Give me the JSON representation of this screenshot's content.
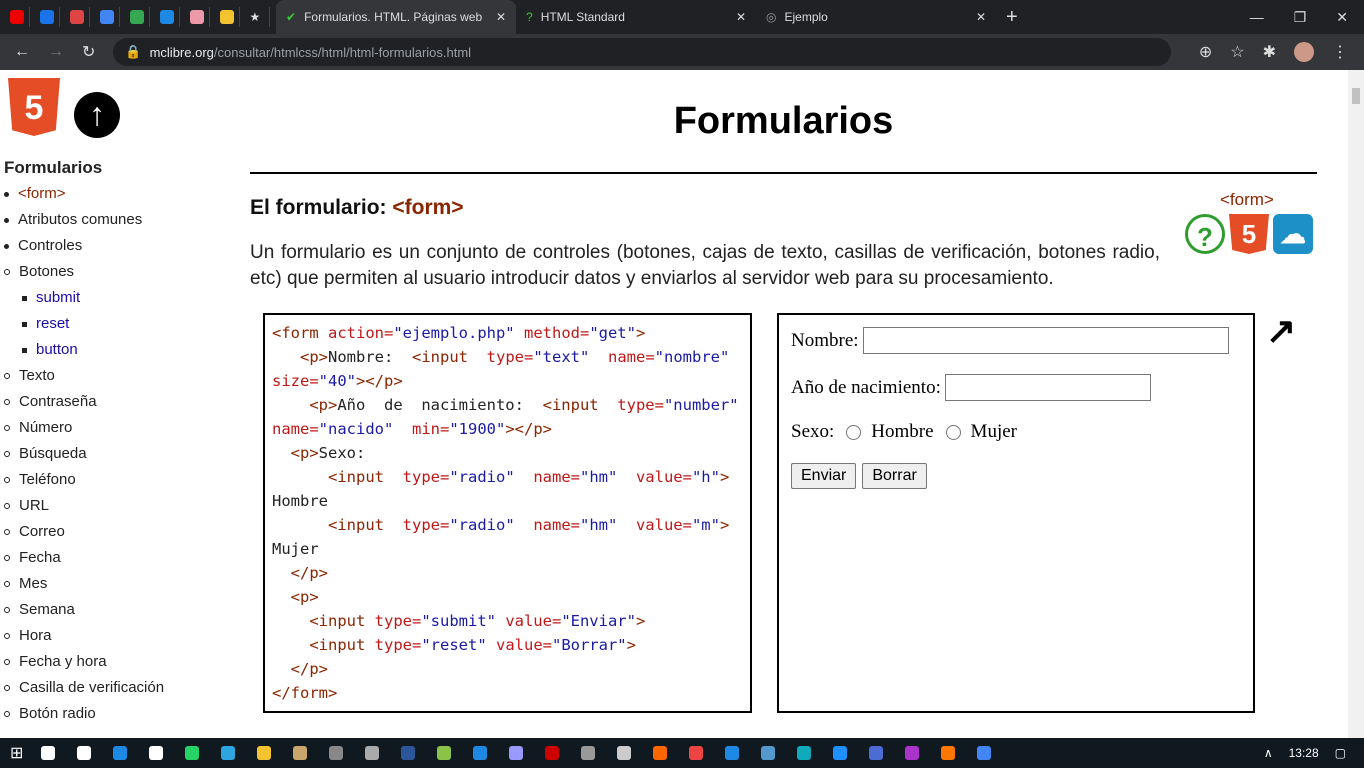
{
  "browser": {
    "bookmarks": [
      {
        "name": "youtube",
        "color": "#e00"
      },
      {
        "name": "dsm",
        "color": "#1a73e8"
      },
      {
        "name": "gmail",
        "color": "#d44"
      },
      {
        "name": "calendar",
        "color": "#4285f4"
      },
      {
        "name": "drive",
        "color": "#34a853"
      },
      {
        "name": "mail",
        "color": "#1e88e5"
      },
      {
        "name": "chrome-app",
        "color": "#e9a"
      },
      {
        "name": "moodle",
        "color": "#f4c430"
      },
      {
        "name": "star",
        "color": "#fff"
      }
    ],
    "tabs": [
      {
        "title": "Formularios. HTML. Páginas web",
        "active": true
      },
      {
        "title": "HTML Standard",
        "active": false
      },
      {
        "title": "Ejemplo",
        "active": false
      }
    ],
    "new_tab": "+",
    "url_host": "mclibre.org",
    "url_path": "/consultar/htmlcss/html/html-formularios.html"
  },
  "sidebar": {
    "title": "Formularios",
    "items": [
      {
        "label": "<form>",
        "level": 1,
        "current": true
      },
      {
        "label": "Atributos comunes",
        "level": 1
      },
      {
        "label": "Controles",
        "level": 1
      },
      {
        "label": "Botones",
        "level": 2
      },
      {
        "label": "submit",
        "level": 3,
        "link": true
      },
      {
        "label": "reset",
        "level": 3,
        "link": true
      },
      {
        "label": "button",
        "level": 3,
        "link": true
      },
      {
        "label": "Texto",
        "level": 2
      },
      {
        "label": "Contraseña",
        "level": 2
      },
      {
        "label": "Número",
        "level": 2
      },
      {
        "label": "Búsqueda",
        "level": 2
      },
      {
        "label": "Teléfono",
        "level": 2
      },
      {
        "label": "URL",
        "level": 2
      },
      {
        "label": "Correo",
        "level": 2
      },
      {
        "label": "Fecha",
        "level": 2
      },
      {
        "label": "Mes",
        "level": 2
      },
      {
        "label": "Semana",
        "level": 2
      },
      {
        "label": "Hora",
        "level": 2
      },
      {
        "label": "Fecha y hora",
        "level": 2
      },
      {
        "label": "Casilla de verificación",
        "level": 2
      },
      {
        "label": "Botón radio",
        "level": 2
      }
    ]
  },
  "main": {
    "title": "Formularios",
    "section_title": "El formulario: ",
    "section_tag": "<form>",
    "ref_tag": "<form>",
    "intro": "Un formulario es un conjunto de controles (botones, cajas de texto, casillas de verificación, botones radio, etc) que permiten al usuario introducir datos y enviarlos al servidor web para su procesamiento.",
    "code": [
      [
        [
          "tg",
          "<form "
        ],
        [
          "at",
          "action="
        ],
        [
          "vl",
          "\"ejemplo.php\""
        ],
        [
          "at",
          " method="
        ],
        [
          "vl",
          "\"get\""
        ],
        [
          "tg",
          ">"
        ]
      ],
      [
        [
          "tg",
          "   <p>"
        ],
        [
          "tx",
          "Nombre:  "
        ],
        [
          "tg",
          "<input  "
        ],
        [
          "at",
          "type="
        ],
        [
          "vl",
          "\"text\""
        ],
        [
          "at",
          "  name="
        ],
        [
          "vl",
          "\"nombre\""
        ]
      ],
      [
        [
          "at",
          "size="
        ],
        [
          "vl",
          "\"40\""
        ],
        [
          "tg",
          "></p>"
        ]
      ],
      [
        [
          "tg",
          "    <p>"
        ],
        [
          "tx",
          "Año  de  nacimiento:  "
        ],
        [
          "tg",
          "<input  "
        ],
        [
          "at",
          "type="
        ],
        [
          "vl",
          "\"number\""
        ]
      ],
      [
        [
          "at",
          "name="
        ],
        [
          "vl",
          "\"nacido\""
        ],
        [
          "at",
          "  min="
        ],
        [
          "vl",
          "\"1900\""
        ],
        [
          "tg",
          "></p>"
        ]
      ],
      [
        [
          "tg",
          "  <p>"
        ],
        [
          "tx",
          "Sexo:"
        ]
      ],
      [
        [
          "tg",
          "      <input  "
        ],
        [
          "at",
          "type="
        ],
        [
          "vl",
          "\"radio\""
        ],
        [
          "at",
          "  name="
        ],
        [
          "vl",
          "\"hm\""
        ],
        [
          "at",
          "  value="
        ],
        [
          "vl",
          "\"h\""
        ],
        [
          "tg",
          ">"
        ]
      ],
      [
        [
          "tx",
          "Hombre"
        ]
      ],
      [
        [
          "tg",
          "      <input  "
        ],
        [
          "at",
          "type="
        ],
        [
          "vl",
          "\"radio\""
        ],
        [
          "at",
          "  name="
        ],
        [
          "vl",
          "\"hm\""
        ],
        [
          "at",
          "  value="
        ],
        [
          "vl",
          "\"m\""
        ],
        [
          "tg",
          ">"
        ]
      ],
      [
        [
          "tx",
          "Mujer"
        ]
      ],
      [
        [
          "tg",
          "  </p>"
        ]
      ],
      [
        [
          "tg",
          "  <p>"
        ]
      ],
      [
        [
          "tg",
          "    <input "
        ],
        [
          "at",
          "type="
        ],
        [
          "vl",
          "\"submit\""
        ],
        [
          "at",
          " value="
        ],
        [
          "vl",
          "\"Enviar\""
        ],
        [
          "tg",
          ">"
        ]
      ],
      [
        [
          "tg",
          "    <input "
        ],
        [
          "at",
          "type="
        ],
        [
          "vl",
          "\"reset\""
        ],
        [
          "at",
          " value="
        ],
        [
          "vl",
          "\"Borrar\""
        ],
        [
          "tg",
          ">"
        ]
      ],
      [
        [
          "tg",
          "  </p>"
        ]
      ],
      [
        [
          "tg",
          "</form>"
        ]
      ]
    ],
    "demo": {
      "nombre_label": "Nombre:",
      "nacido_label": "Año de nacimiento:",
      "sexo_label": "Sexo:",
      "hombre": "Hombre",
      "mujer": "Mujer",
      "submit": "Enviar",
      "reset": "Borrar"
    }
  },
  "taskbar": {
    "clock": "13:28",
    "apps": [
      "#fff",
      "#fff",
      "#1e88e5",
      "#fff",
      "#25d366",
      "#2ca5e0",
      "#f4c430",
      "#c9a66b",
      "#888",
      "#aaa",
      "#2b579a",
      "#8bc34a",
      "#1e88e5",
      "#99f",
      "#c00",
      "#999",
      "#ccc",
      "#f60",
      "#e44",
      "#1e88e5",
      "#59c",
      "#1ab",
      "#1e90ff",
      "#4a6cd4",
      "#a3c",
      "#f70",
      "#4285f4"
    ]
  }
}
